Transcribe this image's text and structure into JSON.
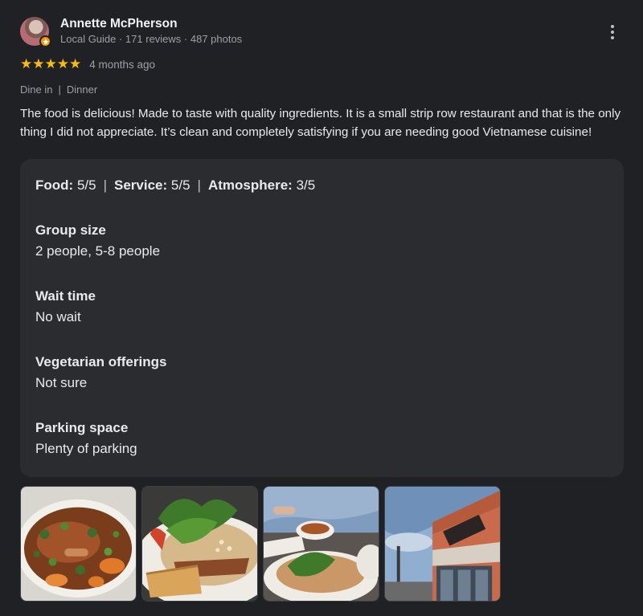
{
  "author": {
    "name": "Annette McPherson",
    "meta": "Local Guide · 171 reviews · 487 photos"
  },
  "rating": {
    "stars": 5,
    "stars_text": "★★★★★",
    "date": "4 months ago"
  },
  "tags": {
    "visit": "Dine in",
    "separator": "|",
    "meal": "Dinner"
  },
  "review_text": "The food is delicious! Made to taste with quality ingredients. It is a small strip row restaurant and that is the only thing I did not appreciate. It’s clean and completely satisfying if you are needing good Vietnamese cuisine!",
  "scores": {
    "food_label": "Food:",
    "food_value": "5/5",
    "service_label": "Service:",
    "service_value": "5/5",
    "atmosphere_label": "Atmosphere:",
    "atmosphere_value": "3/5",
    "separator": "|"
  },
  "attributes": [
    {
      "label": "Group size",
      "value": "2 people, 5-8 people"
    },
    {
      "label": "Wait time",
      "value": "No wait"
    },
    {
      "label": "Vegetarian offerings",
      "value": "Not sure"
    },
    {
      "label": "Parking space",
      "value": "Plenty of parking"
    }
  ],
  "photos": [
    {
      "subject": "soup-bowl-photo"
    },
    {
      "subject": "vermicelli-plate-photo"
    },
    {
      "subject": "table-dishes-photo"
    },
    {
      "subject": "restaurant-storefront-photo"
    }
  ],
  "colors": {
    "background": "#202124",
    "card": "#2b2c2f",
    "star": "#fbbc04",
    "muted_text": "#9aa0a6",
    "badge": "#f29900"
  }
}
